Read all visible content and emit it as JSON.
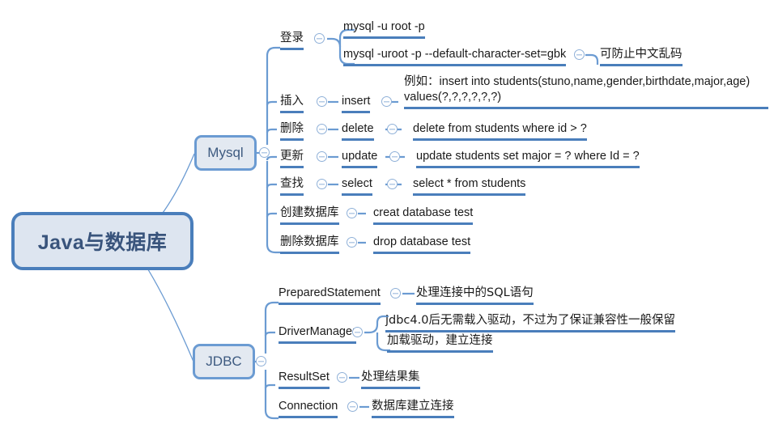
{
  "diagram": {
    "title": "Java与数据库",
    "type": "mindmap",
    "colors": {
      "root_border": "#4a7ebb",
      "root_fill": "#dde5f0",
      "root_text": "#39547c",
      "node_border": "#6b9bd2",
      "node_fill": "#e3e9f1",
      "node_text": "#3d5a80",
      "underline": "#4a7ebb",
      "connector": "#6b9bd2",
      "icon": "#8fb0d8",
      "background": "#ffffff"
    }
  },
  "root": {
    "label": "Java与数据库"
  },
  "branches": [
    {
      "label": "Mysql",
      "children": [
        {
          "label": "登录",
          "children": [
            {
              "label": "mysql -u root -p"
            },
            {
              "label": "mysql -uroot -p --default-character-set=gbk",
              "children": [
                {
                  "label": "可防止中文乱码"
                }
              ]
            }
          ]
        },
        {
          "label": "插入",
          "children": [
            {
              "label": "insert",
              "children": [
                {
                  "label": "例如：insert into students(stuno,name,gender,birthdate,major,age) values(?,?,?,?,?,?)"
                }
              ]
            }
          ]
        },
        {
          "label": "删除",
          "children": [
            {
              "label": "delete",
              "children": [
                {
                  "label": "delete from students where id > ?"
                }
              ]
            }
          ]
        },
        {
          "label": "更新",
          "children": [
            {
              "label": "update",
              "children": [
                {
                  "label": "update students set major = ? where Id = ?"
                }
              ]
            }
          ]
        },
        {
          "label": "查找",
          "children": [
            {
              "label": "select",
              "children": [
                {
                  "label": "select * from students"
                }
              ]
            }
          ]
        },
        {
          "label": "创建数据库",
          "children": [
            {
              "label": "creat database test"
            }
          ]
        },
        {
          "label": "删除数据库",
          "children": [
            {
              "label": "drop database test"
            }
          ]
        }
      ]
    },
    {
      "label": "JDBC",
      "children": [
        {
          "label": "PreparedStatement",
          "children": [
            {
              "label": "处理连接中的SQL语句"
            }
          ]
        },
        {
          "label": "DriverManager",
          "children": [
            {
              "label": "jdbc4.0后无需载入驱动，不过为了保证兼容性一般保留"
            },
            {
              "label": "加载驱动，建立连接"
            }
          ]
        },
        {
          "label": "ResultSet",
          "children": [
            {
              "label": "处理结果集"
            }
          ]
        },
        {
          "label": "Connection",
          "children": [
            {
              "label": "数据库建立连接"
            }
          ]
        }
      ]
    }
  ],
  "cells": {
    "login": "登录",
    "login_cmd1": "mysql -u root -p",
    "login_cmd2": "mysql -uroot -p --default-character-set=gbk",
    "login_note": "可防止中文乱码",
    "insert": "插入",
    "insert_kw": "insert",
    "insert_example": "例如：insert into students(stuno,name,gender,birthdate,major,age) values(?,?,?,?,?,?)",
    "delete": "删除",
    "delete_kw": "delete",
    "delete_example": "delete from students where id > ?",
    "update": "更新",
    "update_kw": "update",
    "update_example": "update students set major = ? where Id = ?",
    "select": "查找",
    "select_kw": "select",
    "select_example": "select * from students",
    "create_db": "创建数据库",
    "create_db_cmd": "creat database test",
    "drop_db": "删除数据库",
    "drop_db_cmd": "drop database test",
    "prepared": "PreparedStatement",
    "prepared_desc": "处理连接中的SQL语句",
    "driver": "DriverManager",
    "driver_note1": "jdbc4.0后无需载入驱动，不过为了保证兼容性一般保留",
    "driver_note2": "加载驱动，建立连接",
    "resultset": "ResultSet",
    "resultset_desc": "处理结果集",
    "connection": "Connection",
    "connection_desc": "数据库建立连接"
  },
  "icons": {
    "collapse": "circle-minus-icon"
  }
}
